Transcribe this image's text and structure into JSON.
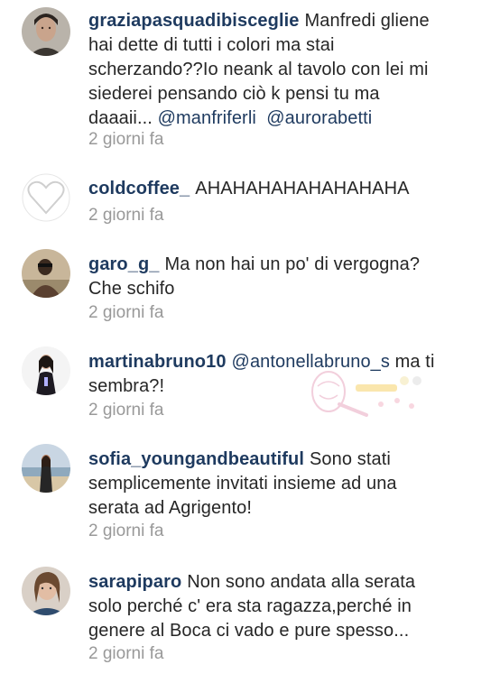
{
  "comments": [
    {
      "username": "graziapasquadibisceglie",
      "text_lines": [
        "Manfredi gliene",
        "hai dette di tutti i colori ma stai",
        "scherzando??Io neank al tavolo con lei mi",
        "siederei pensando ciò k pensi tu ma",
        "daaaii... "
      ],
      "mention1": "@manfriferli",
      "mention2": "@aurorabetti",
      "time": "2 giorni fa",
      "avatar": "woman-portrait-avatar"
    },
    {
      "username": "coldcoffee_",
      "text": "AHAHAHAHAHAHAHAHA",
      "time": "2 giorni fa",
      "avatar": "heart-outline-avatar"
    },
    {
      "username": "garo_g_",
      "text_lines": [
        "Ma non hai un po' di vergogna?",
        "Che schifo"
      ],
      "time": "2 giorni fa",
      "avatar": "man-photo-avatar"
    },
    {
      "username": "martinabruno10",
      "mention": "@antonellabruno_s",
      "text_after": " ma ti",
      "text_line2": "sembra?!",
      "time": "2 giorni fa",
      "avatar": "girl-photo-avatar"
    },
    {
      "username": "sofia_youngandbeautiful",
      "text_lines": [
        "Sono stati",
        "semplicemente invitati insieme ad una",
        "serata ad Agrigento!"
      ],
      "time": "2 giorni fa",
      "avatar": "beach-photo-avatar"
    },
    {
      "username": "sarapiparo",
      "text_lines": [
        "Non sono andata alla serata",
        "solo perché c' era sta ragazza,perché in",
        "genere al Boca ci vado e pure spesso..."
      ],
      "time": "2 giorni fa",
      "avatar": "selfie-avatar"
    }
  ],
  "colors": {
    "username": "#1e3a5f",
    "text": "#262626",
    "timestamp": "#999999"
  }
}
